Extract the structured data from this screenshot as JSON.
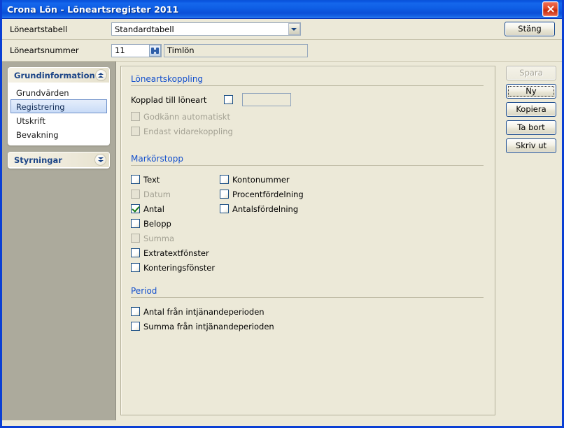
{
  "window": {
    "title": "Crona Lön - Löneartsregister 2011",
    "close_icon": "close-icon",
    "accent_titlebar": "#0f5fe6",
    "panel_bg": "#ece9d8",
    "sidebar_bg": "#acaa9c",
    "section_heading_color": "#1450cd"
  },
  "header": {
    "table_label": "Löneartstabell",
    "table_value": "Standardtabell",
    "table_options": [
      "Standardtabell"
    ],
    "number_label": "Löneartsnummer",
    "number_value": "11",
    "browse_icon": "binoculars-icon",
    "name_value": "Timlön",
    "close_button": "Stäng"
  },
  "sidebar": {
    "panels": [
      {
        "title": "Grundinformation",
        "toggle_icon": "chevron-double-up-icon",
        "expanded": true,
        "items": [
          {
            "label": "Grundvärden",
            "selected": false
          },
          {
            "label": "Registrering",
            "selected": true
          },
          {
            "label": "Utskrift",
            "selected": false
          },
          {
            "label": "Bevakning",
            "selected": false
          }
        ]
      },
      {
        "title": "Styrningar",
        "toggle_icon": "chevron-double-down-icon",
        "expanded": false,
        "items": []
      }
    ]
  },
  "main": {
    "sections": [
      {
        "title": "Löneartskoppling",
        "linked_label": "Kopplad till löneart",
        "linked_checked": false,
        "linked_value": "",
        "options": [
          {
            "label": "Godkänn automatiskt",
            "checked": false,
            "disabled": true
          },
          {
            "label": "Endast vidarekoppling",
            "checked": false,
            "disabled": true
          }
        ]
      },
      {
        "title": "Markörstopp",
        "left_column": [
          {
            "label": "Text",
            "checked": false,
            "disabled": false
          },
          {
            "label": "Datum",
            "checked": false,
            "disabled": true
          },
          {
            "label": "Antal",
            "checked": true,
            "disabled": false
          },
          {
            "label": "Belopp",
            "checked": false,
            "disabled": false
          },
          {
            "label": "Summa",
            "checked": false,
            "disabled": true
          },
          {
            "label": "Extratextfönster",
            "checked": false,
            "disabled": false
          },
          {
            "label": "Konteringsfönster",
            "checked": false,
            "disabled": false
          }
        ],
        "right_column": [
          {
            "label": "Kontonummer",
            "checked": false,
            "disabled": false
          },
          {
            "label": "Procentfördelning",
            "checked": false,
            "disabled": false
          },
          {
            "label": "Antalsfördelning",
            "checked": false,
            "disabled": false
          }
        ]
      },
      {
        "title": "Period",
        "items": [
          {
            "label": "Antal från intjänandeperioden",
            "checked": false,
            "disabled": false
          },
          {
            "label": "Summa från intjänandeperioden",
            "checked": false,
            "disabled": false
          }
        ]
      }
    ]
  },
  "actions": {
    "buttons": [
      {
        "label": "Spara",
        "disabled": true,
        "focused": false
      },
      {
        "label": "Ny",
        "disabled": false,
        "focused": true
      },
      {
        "label": "Kopiera",
        "disabled": false,
        "focused": false
      },
      {
        "label": "Ta bort",
        "disabled": false,
        "focused": false
      },
      {
        "label": "Skriv ut",
        "disabled": false,
        "focused": false
      }
    ]
  }
}
